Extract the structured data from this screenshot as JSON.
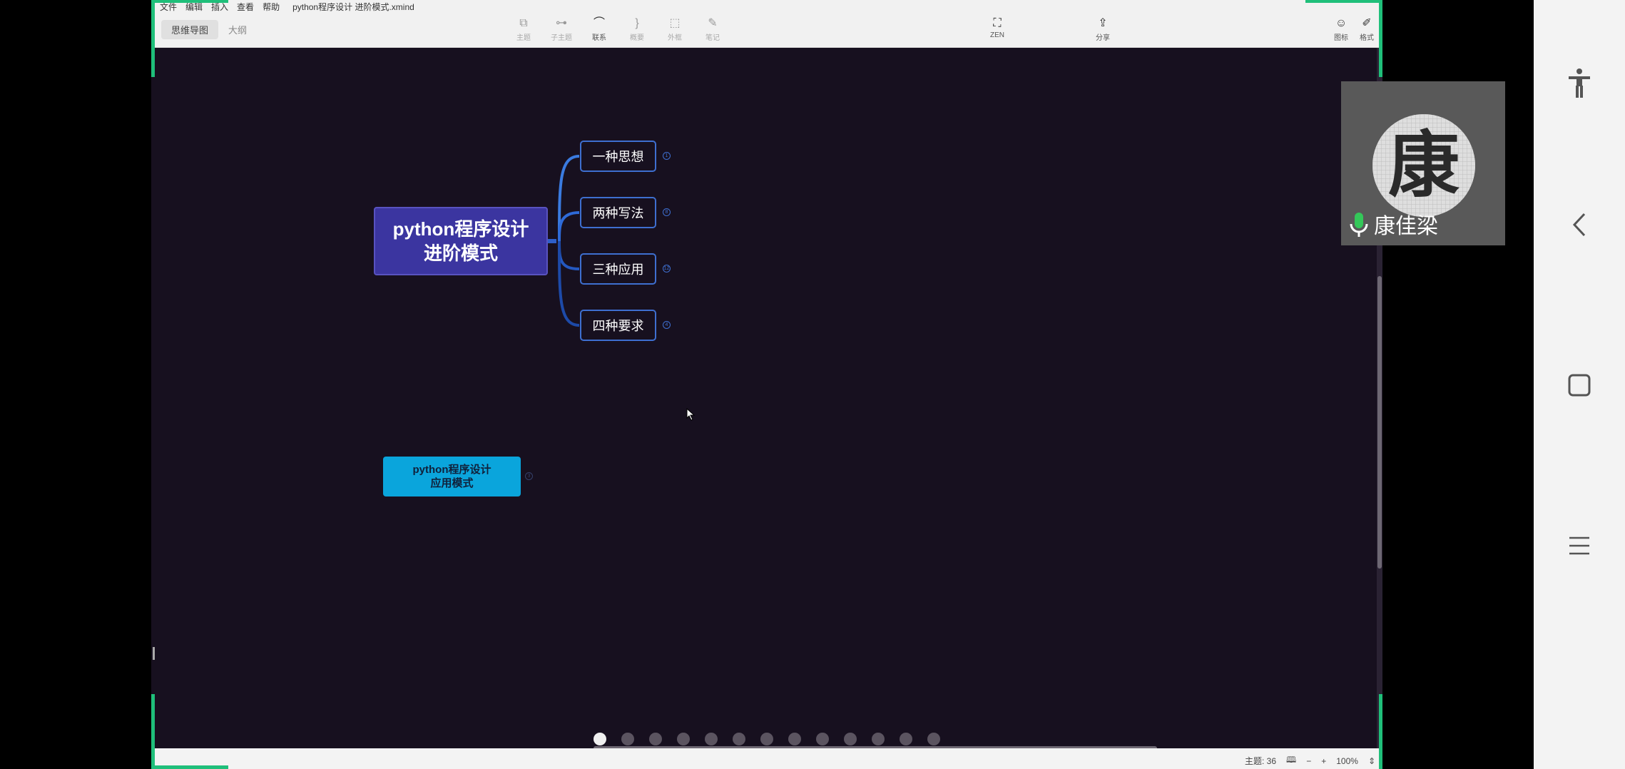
{
  "menu": {
    "items": [
      "文件",
      "编辑",
      "插入",
      "查看",
      "帮助"
    ],
    "filename": "python程序设计 进阶模式.xmind"
  },
  "view_toggle": {
    "mindmap": "思维导图",
    "outline": "大纲"
  },
  "toolbar": {
    "topic": "主题",
    "subtopic": "子主题",
    "relation": "联系",
    "summary": "概要",
    "boundary": "外框",
    "note": "笔记",
    "zen": "ZEN",
    "share": "分享",
    "icon": "图标",
    "style": "格式"
  },
  "map": {
    "central": "python程序设计进阶模式",
    "central_line1": "python程序设计",
    "central_line2": "进阶模式",
    "branches": [
      "一种思想",
      "两种写法",
      "三种应用",
      "四种要求"
    ],
    "branch_badges": [
      "1",
      "8",
      "12",
      "4"
    ],
    "floating": {
      "line1": "python程序设计",
      "line2": "应用模式",
      "badge": "3"
    }
  },
  "pagination": {
    "count": 13,
    "active_index": 0
  },
  "status": {
    "topics": "主题: 36",
    "zoom": "100%"
  },
  "video": {
    "name": "康佳梁",
    "avatar_char": "康"
  },
  "colors": {
    "canvas": "#17101f",
    "central": "#3b35a0",
    "branch_border": "#3e6fd0",
    "floating": "#0aa5dc",
    "accent_green": "#1fbf7a"
  }
}
